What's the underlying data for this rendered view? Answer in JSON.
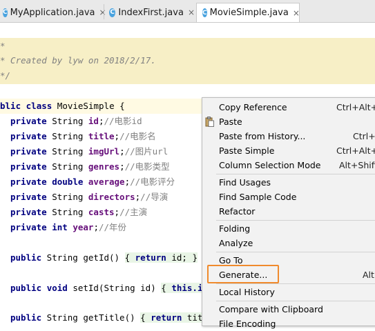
{
  "tabs": [
    {
      "label": "MyApplication.java",
      "icon": "class-icon",
      "close": "×"
    },
    {
      "label": "IndexFirst.java",
      "icon": "class-icon",
      "close": "×"
    },
    {
      "label": "MovieSimple.java",
      "icon": "class-icon",
      "close": "×",
      "active": true
    }
  ],
  "tab_icon_letter": "C",
  "comment": {
    "line1": "*",
    "line2": "* Created by lyw on 2018/2/17.",
    "line3": "*/"
  },
  "code": {
    "class_kw1": "blic",
    "class_kw2": "class",
    "class_name": " MovieSimple {",
    "fields": [
      {
        "mod": "private",
        "type": "String",
        "name": "id",
        "comment": "//电影id"
      },
      {
        "mod": "private",
        "type": "String",
        "name": "title",
        "comment": "//电影名"
      },
      {
        "mod": "private",
        "type": "String",
        "name": "imgUrl",
        "comment": "//图片url"
      },
      {
        "mod": "private",
        "type": "String",
        "name": "genres",
        "comment": "//电影类型"
      },
      {
        "mod": "private",
        "type": "double",
        "name": "average",
        "comment": "//电影评分"
      },
      {
        "mod": "private",
        "type": "String",
        "name": "directors",
        "comment": "//导演"
      },
      {
        "mod": "private",
        "type": "String",
        "name": "casts",
        "comment": "//主演"
      },
      {
        "mod": "private",
        "type": "int",
        "name": "year",
        "comment": "//年份"
      }
    ],
    "getid": {
      "pre": "public",
      "type": " String getId() ",
      "open": "{ ",
      "ret": "return",
      "val": " id; ",
      "close": "}"
    },
    "setid": {
      "pre": "public",
      "void": "void",
      "sig": " setId(String id) ",
      "open": "{ ",
      "this": "this.i"
    },
    "gettitle": {
      "pre": "public",
      "type": " String getTitle() ",
      "open": "{ ",
      "ret": "return",
      "val": " tit"
    }
  },
  "context_menu": {
    "items": [
      {
        "label": "Copy Reference",
        "shortcut": "Ctrl+Alt+S"
      },
      {
        "label": "Paste",
        "shortcut": "",
        "icon": "paste-icon"
      },
      {
        "label": "Paste from History...",
        "shortcut": "Ctrl+S"
      },
      {
        "label": "Paste Simple",
        "shortcut": "Ctrl+Alt+S"
      },
      {
        "label": "Column Selection Mode",
        "shortcut": "Alt+Shift+"
      },
      {
        "label": "Find Usages",
        "shortcut": ""
      },
      {
        "label": "Find Sample Code",
        "shortcut": ""
      },
      {
        "label": "Refactor",
        "shortcut": ""
      },
      {
        "label": "Folding",
        "shortcut": ""
      },
      {
        "label": "Analyze",
        "shortcut": ""
      },
      {
        "label": "Go To",
        "shortcut": ""
      },
      {
        "label": "Generate...",
        "shortcut": "Alt+"
      },
      {
        "label": "Local History",
        "shortcut": ""
      },
      {
        "label": "Compare with Clipboard",
        "shortcut": ""
      },
      {
        "label": "File Encoding",
        "shortcut": ""
      }
    ]
  },
  "colors": {
    "highlight_box": "#f08a2c",
    "comment_bg": "#f7efc6",
    "keyword": "#000080",
    "field": "#660e7a"
  }
}
